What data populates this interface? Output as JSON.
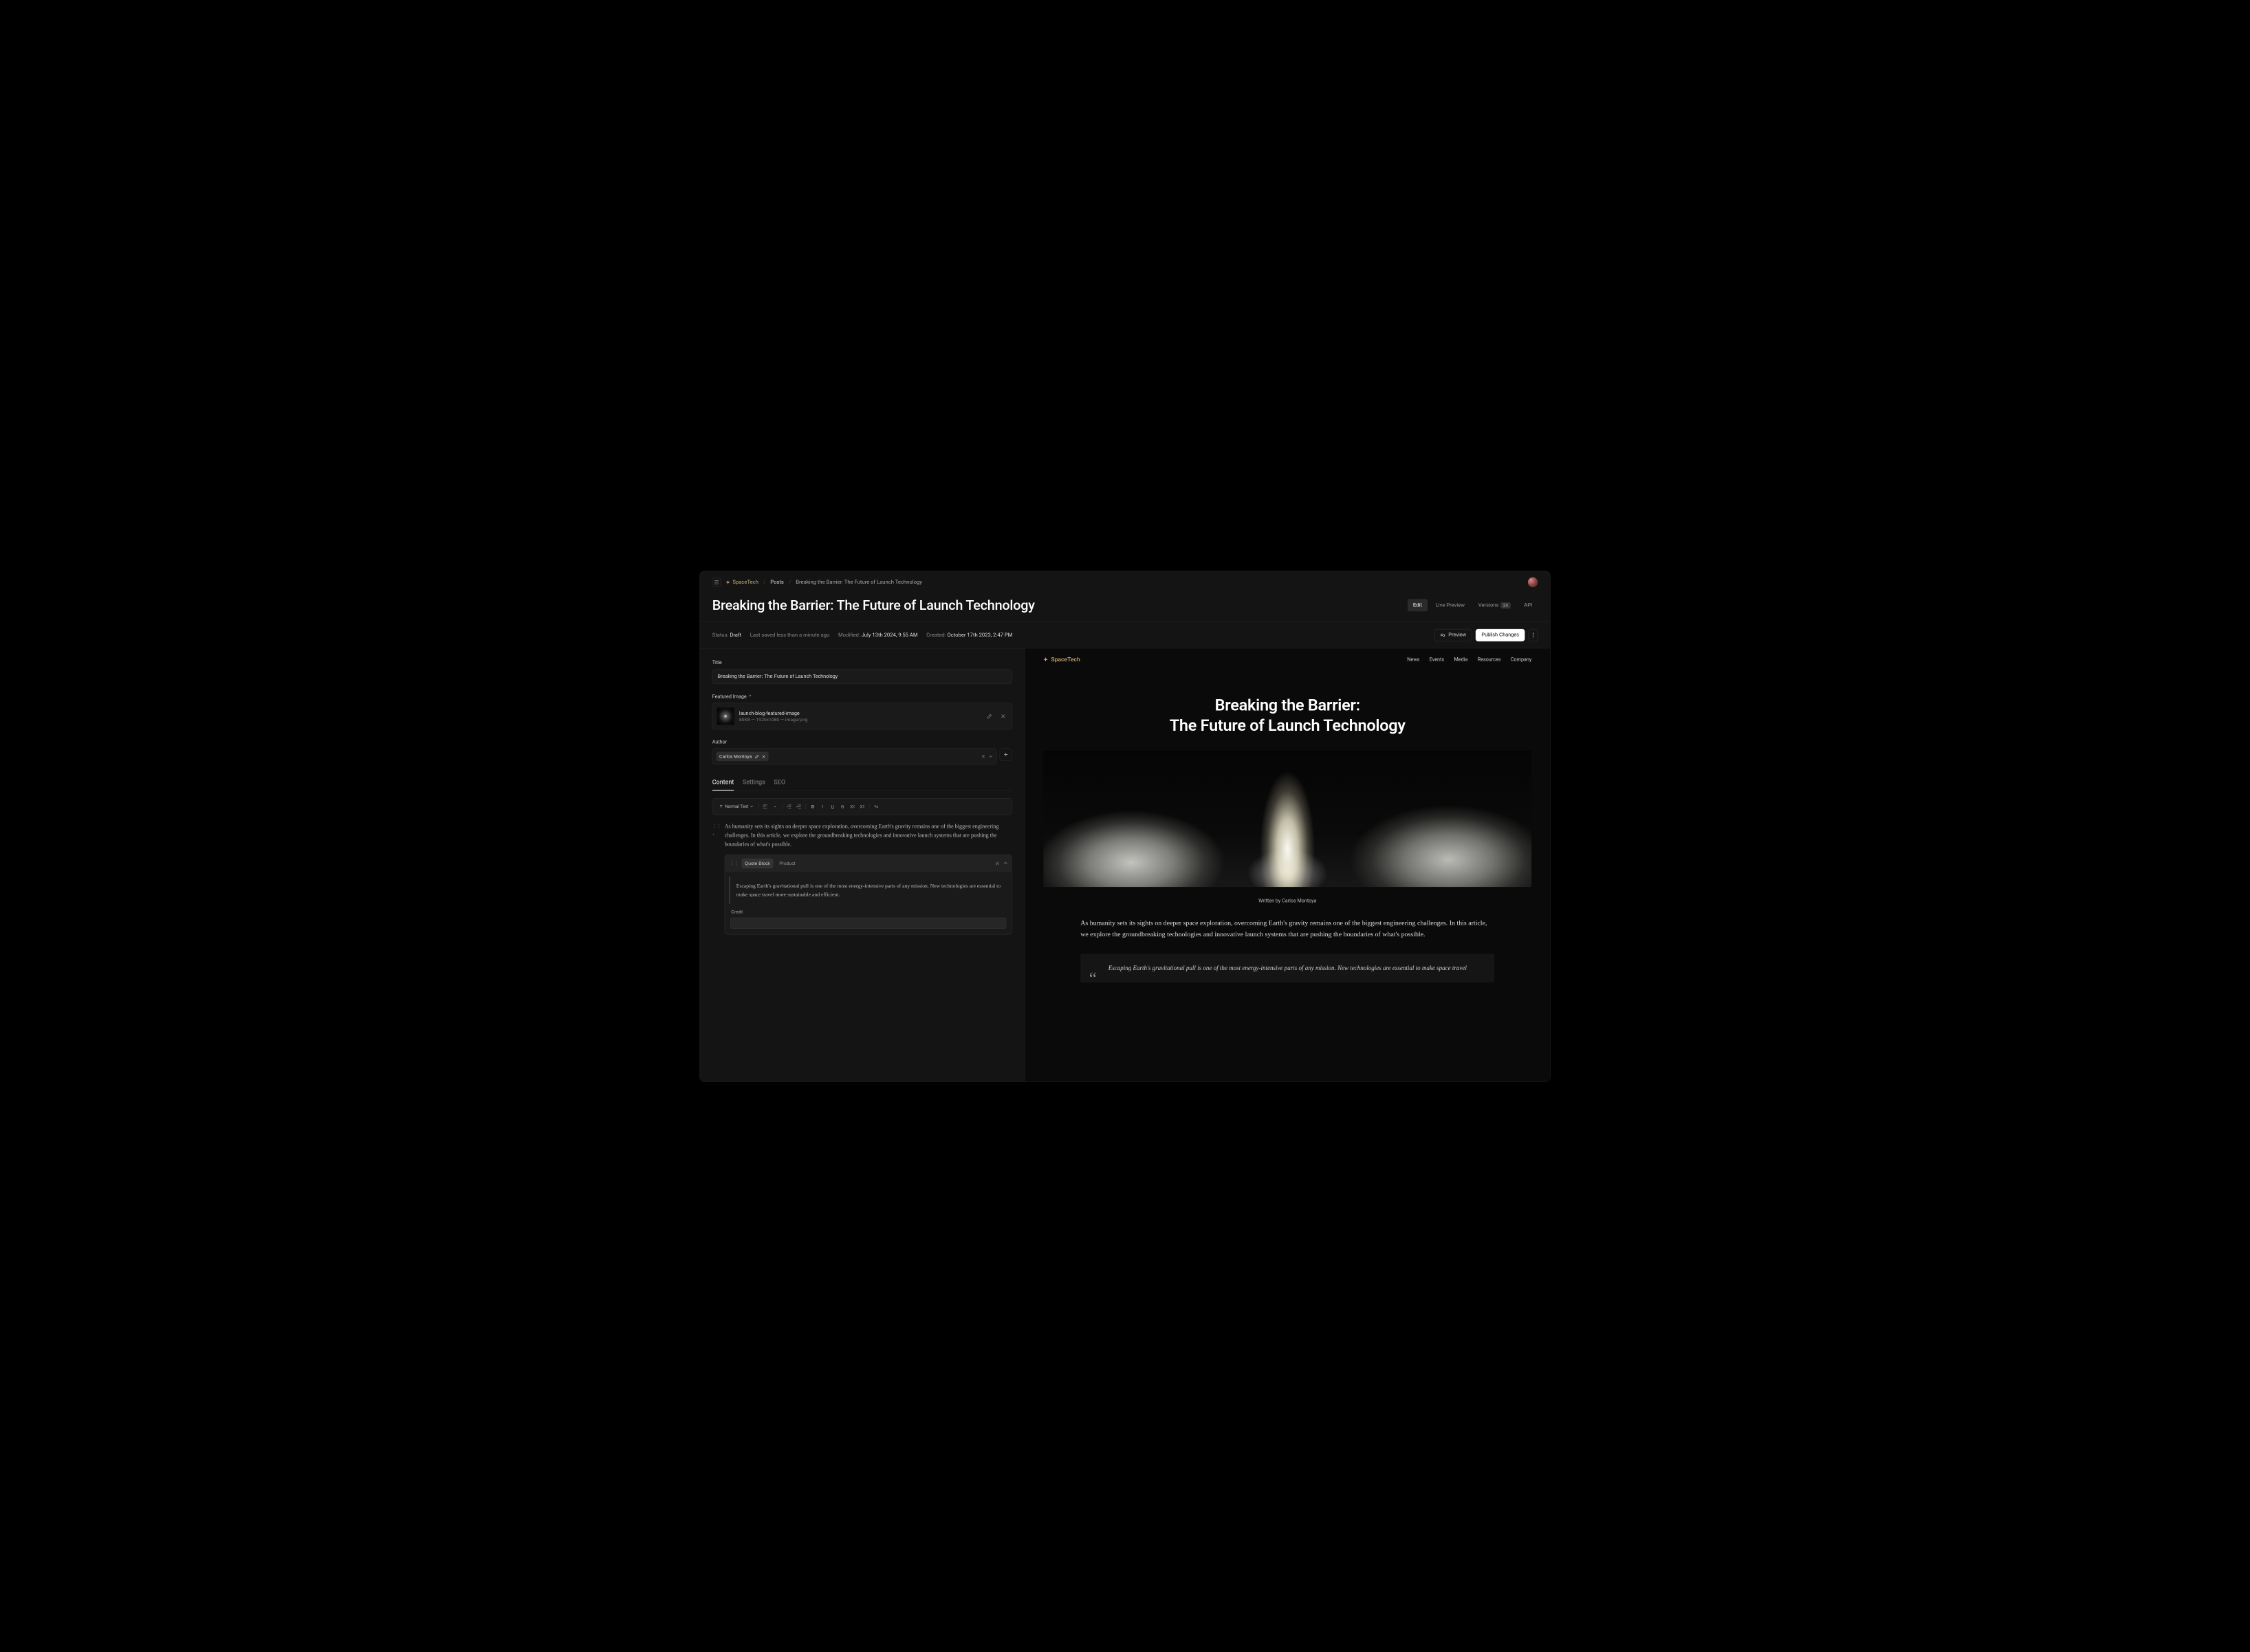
{
  "breadcrumb": {
    "brand": "SpaceTech",
    "section": "Posts",
    "page": "Breaking the Barrier: The Future of Launch Technology"
  },
  "title": "Breaking the Barrier: The Future of Launch Technology",
  "tabs": {
    "edit": "Edit",
    "live_preview": "Live Preview",
    "versions": "Versions",
    "versions_count": "24",
    "api": "API"
  },
  "status": {
    "label": "Status:",
    "value": "Draft",
    "saved": "Last saved less than a minute ago",
    "modified_label": "Modified:",
    "modified": "July 13th 2024, 9:55 AM",
    "created_label": "Created:",
    "created": "October 17th 2023, 2:47 PM",
    "preview": "Preview",
    "publish": "Publish Changes"
  },
  "form": {
    "title_label": "Title",
    "title_value": "Breaking the Barrier: The Future of Launch Technology",
    "image_label": "Featured Image",
    "image_name": "launch-blog-featured-image",
    "image_meta": "80KB — 1920x1080 — image/png",
    "author_label": "Author",
    "author_name": "Carlos Montoya"
  },
  "subtabs": {
    "content": "Content",
    "settings": "Settings",
    "seo": "SEO"
  },
  "toolbar": {
    "format": "Normal Text"
  },
  "editor": {
    "intro": "As humanity sets its sights on deeper space exploration, overcoming Earth's gravity remains one of the biggest engineering challenges. In this article, we explore the groundbreaking technologies and innovative launch systems that are pushing the boundaries of what's possible.",
    "block_type": "Quote Block",
    "block_tag": "Product",
    "quote": "Escaping Earth's gravitational pull is one of the most energy-intensive parts of any mission. New technologies are essential to make space travel more sustainable and efficient.",
    "credit_label": "Credit"
  },
  "preview": {
    "brand": "SpaceTech",
    "nav": {
      "news": "News",
      "events": "Events",
      "media": "Media",
      "resources": "Resources",
      "company": "Company"
    },
    "title_l1": "Breaking the Barrier:",
    "title_l2": "The Future of Launch Technology",
    "byline": "Written by Carlos Montoya",
    "intro": "As humanity sets its sights on deeper space exploration, overcoming Earth's gravity remains one of the biggest engineering challenges. In this article, we explore the groundbreaking technologies and innovative launch systems that are pushing the boundaries of what's possible.",
    "quote": "Escaping Earth's gravitational pull is one of the most energy-intensive parts of any mission. New technologies are essential to make space travel"
  }
}
